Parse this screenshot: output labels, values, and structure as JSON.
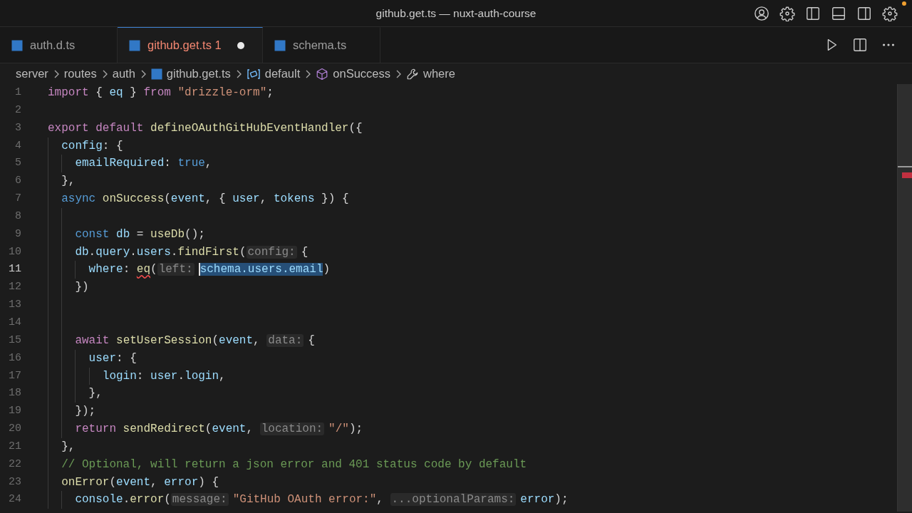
{
  "window": {
    "title": "github.get.ts — nuxt-auth-course",
    "notification": true
  },
  "tabs": [
    {
      "label": "auth.d.ts",
      "selected": false,
      "modified": false
    },
    {
      "label": "github.get.ts",
      "selected": true,
      "problems": "1",
      "modified": true
    },
    {
      "label": "schema.ts",
      "selected": false,
      "modified": false
    }
  ],
  "breadcrumbs": [
    {
      "label": "server",
      "kind": "folder"
    },
    {
      "label": "routes",
      "kind": "folder"
    },
    {
      "label": "auth",
      "kind": "folder"
    },
    {
      "label": "github.get.ts",
      "kind": "file"
    },
    {
      "label": "default",
      "kind": "variable"
    },
    {
      "label": "onSuccess",
      "kind": "method"
    },
    {
      "label": "where",
      "kind": "property"
    }
  ],
  "lines": [
    {
      "number": "1",
      "current": false,
      "tokens": [
        {
          "text": "import",
          "kind": "keyword"
        },
        {
          "text": " { ",
          "kind": "plain"
        },
        {
          "text": "eq",
          "kind": "variable"
        },
        {
          "text": " } ",
          "kind": "plain"
        },
        {
          "text": "from",
          "kind": "keyword"
        },
        {
          "text": " \"drizzle-orm\"",
          "kind": "string"
        },
        {
          "text": ";",
          "kind": "plain"
        }
      ]
    },
    {
      "number": "2",
      "current": false
    },
    {
      "number": "3",
      "current": false,
      "tokens": [
        {
          "text": "export",
          "kind": "keyword"
        },
        {
          "text": " default",
          "kind": "keyword"
        },
        {
          "text": " defineOAuthGitHubEventHandler",
          "kind": "function"
        },
        {
          "text": "({",
          "kind": "plain"
        }
      ]
    },
    {
      "number": "4",
      "current": false,
      "tokens": [
        {
          "text": "  config",
          "kind": "variable"
        },
        {
          "text": ": {",
          "kind": "plain"
        }
      ]
    },
    {
      "number": "5",
      "current": false,
      "tokens": [
        {
          "text": "    emailRequired",
          "kind": "variable"
        },
        {
          "text": ": ",
          "kind": "plain"
        },
        {
          "text": "true",
          "kind": "constant"
        },
        {
          "text": ",",
          "kind": "plain"
        }
      ]
    },
    {
      "number": "6",
      "current": false,
      "tokens": [
        {
          "text": "  },",
          "kind": "plain"
        }
      ]
    },
    {
      "number": "7",
      "current": false,
      "tokens": [
        {
          "text": "  async",
          "kind": "constant"
        },
        {
          "text": " onSuccess",
          "kind": "function"
        },
        {
          "text": "(",
          "kind": "plain"
        },
        {
          "text": "event",
          "kind": "variable"
        },
        {
          "text": ", { ",
          "kind": "plain"
        },
        {
          "text": "user",
          "kind": "variable"
        },
        {
          "text": ", ",
          "kind": "plain"
        },
        {
          "text": "tokens",
          "kind": "variable"
        },
        {
          "text": " }) {",
          "kind": "plain"
        }
      ]
    },
    {
      "number": "8",
      "current": false
    },
    {
      "number": "9",
      "current": false,
      "tokens": [
        {
          "text": "    const",
          "kind": "constant"
        },
        {
          "text": " db",
          "kind": "variable"
        },
        {
          "text": " = ",
          "kind": "plain"
        },
        {
          "text": "useDb",
          "kind": "function"
        },
        {
          "text": "();",
          "kind": "plain"
        }
      ]
    },
    {
      "number": "10",
      "current": false,
      "tokens": [
        {
          "text": "    db",
          "kind": "variable"
        },
        {
          "text": ".",
          "kind": "plain"
        },
        {
          "text": "query",
          "kind": "variable"
        },
        {
          "text": ".",
          "kind": "plain"
        },
        {
          "text": "users",
          "kind": "variable"
        },
        {
          "text": ".",
          "kind": "plain"
        },
        {
          "text": "findFirst",
          "kind": "function"
        },
        {
          "text": "(",
          "kind": "plain"
        },
        {
          "text": "config:",
          "kind": "hint"
        },
        {
          "text": "{",
          "kind": "plain"
        }
      ]
    },
    {
      "number": "11",
      "current": true,
      "tokens": [
        {
          "text": "      where",
          "kind": "variable"
        },
        {
          "text": ": ",
          "kind": "plain"
        },
        {
          "text": "eq",
          "kind": "error"
        },
        {
          "text": "(",
          "kind": "plain"
        },
        {
          "text": "left:",
          "kind": "hint"
        },
        {
          "text": "schema.users.email",
          "kind": "selected"
        },
        {
          "text": ")",
          "kind": "plain"
        }
      ]
    },
    {
      "number": "12",
      "current": false,
      "tokens": [
        {
          "text": "    })",
          "kind": "plain"
        }
      ]
    },
    {
      "number": "13",
      "current": false
    },
    {
      "number": "14",
      "current": false
    },
    {
      "number": "15",
      "current": false,
      "tokens": [
        {
          "text": "    await",
          "kind": "keyword"
        },
        {
          "text": " setUserSession",
          "kind": "function"
        },
        {
          "text": "(",
          "kind": "plain"
        },
        {
          "text": "event",
          "kind": "variable"
        },
        {
          "text": ", ",
          "kind": "plain"
        },
        {
          "text": "data:",
          "kind": "hint"
        },
        {
          "text": "{",
          "kind": "plain"
        }
      ]
    },
    {
      "number": "16",
      "current": false,
      "tokens": [
        {
          "text": "      user",
          "kind": "variable"
        },
        {
          "text": ": {",
          "kind": "plain"
        }
      ]
    },
    {
      "number": "17",
      "current": false,
      "tokens": [
        {
          "text": "        login",
          "kind": "variable"
        },
        {
          "text": ": ",
          "kind": "plain"
        },
        {
          "text": "user",
          "kind": "variable"
        },
        {
          "text": ".",
          "kind": "plain"
        },
        {
          "text": "login",
          "kind": "variable"
        },
        {
          "text": ",",
          "kind": "plain"
        }
      ]
    },
    {
      "number": "18",
      "current": false,
      "tokens": [
        {
          "text": "      },",
          "kind": "plain"
        }
      ]
    },
    {
      "number": "19",
      "current": false,
      "tokens": [
        {
          "text": "    });",
          "kind": "plain"
        }
      ]
    },
    {
      "number": "20",
      "current": false,
      "tokens": [
        {
          "text": "    return",
          "kind": "keyword"
        },
        {
          "text": " sendRedirect",
          "kind": "function"
        },
        {
          "text": "(",
          "kind": "plain"
        },
        {
          "text": "event",
          "kind": "variable"
        },
        {
          "text": ", ",
          "kind": "plain"
        },
        {
          "text": "location:",
          "kind": "hint"
        },
        {
          "text": "\"/\"",
          "kind": "string"
        },
        {
          "text": ");",
          "kind": "plain"
        }
      ]
    },
    {
      "number": "21",
      "current": false,
      "tokens": [
        {
          "text": "  },",
          "kind": "plain"
        }
      ]
    },
    {
      "number": "22",
      "current": false,
      "tokens": [
        {
          "text": "  // Optional, will return a json error and 401 status code by default",
          "kind": "comment"
        }
      ]
    },
    {
      "number": "23",
      "current": false,
      "tokens": [
        {
          "text": "  onError",
          "kind": "function"
        },
        {
          "text": "(",
          "kind": "plain"
        },
        {
          "text": "event",
          "kind": "variable"
        },
        {
          "text": ", ",
          "kind": "plain"
        },
        {
          "text": "error",
          "kind": "variable"
        },
        {
          "text": ") {",
          "kind": "plain"
        }
      ]
    },
    {
      "number": "24",
      "current": false,
      "tokens": [
        {
          "text": "    console",
          "kind": "variable"
        },
        {
          "text": ".",
          "kind": "plain"
        },
        {
          "text": "error",
          "kind": "function"
        },
        {
          "text": "(",
          "kind": "plain"
        },
        {
          "text": "message:",
          "kind": "hint"
        },
        {
          "text": "\"GitHub OAuth error:\"",
          "kind": "string"
        },
        {
          "text": ", ",
          "kind": "plain"
        },
        {
          "text": "...optionalParams:",
          "kind": "hint"
        },
        {
          "text": "error",
          "kind": "variable"
        },
        {
          "text": ");",
          "kind": "plain"
        }
      ]
    }
  ]
}
